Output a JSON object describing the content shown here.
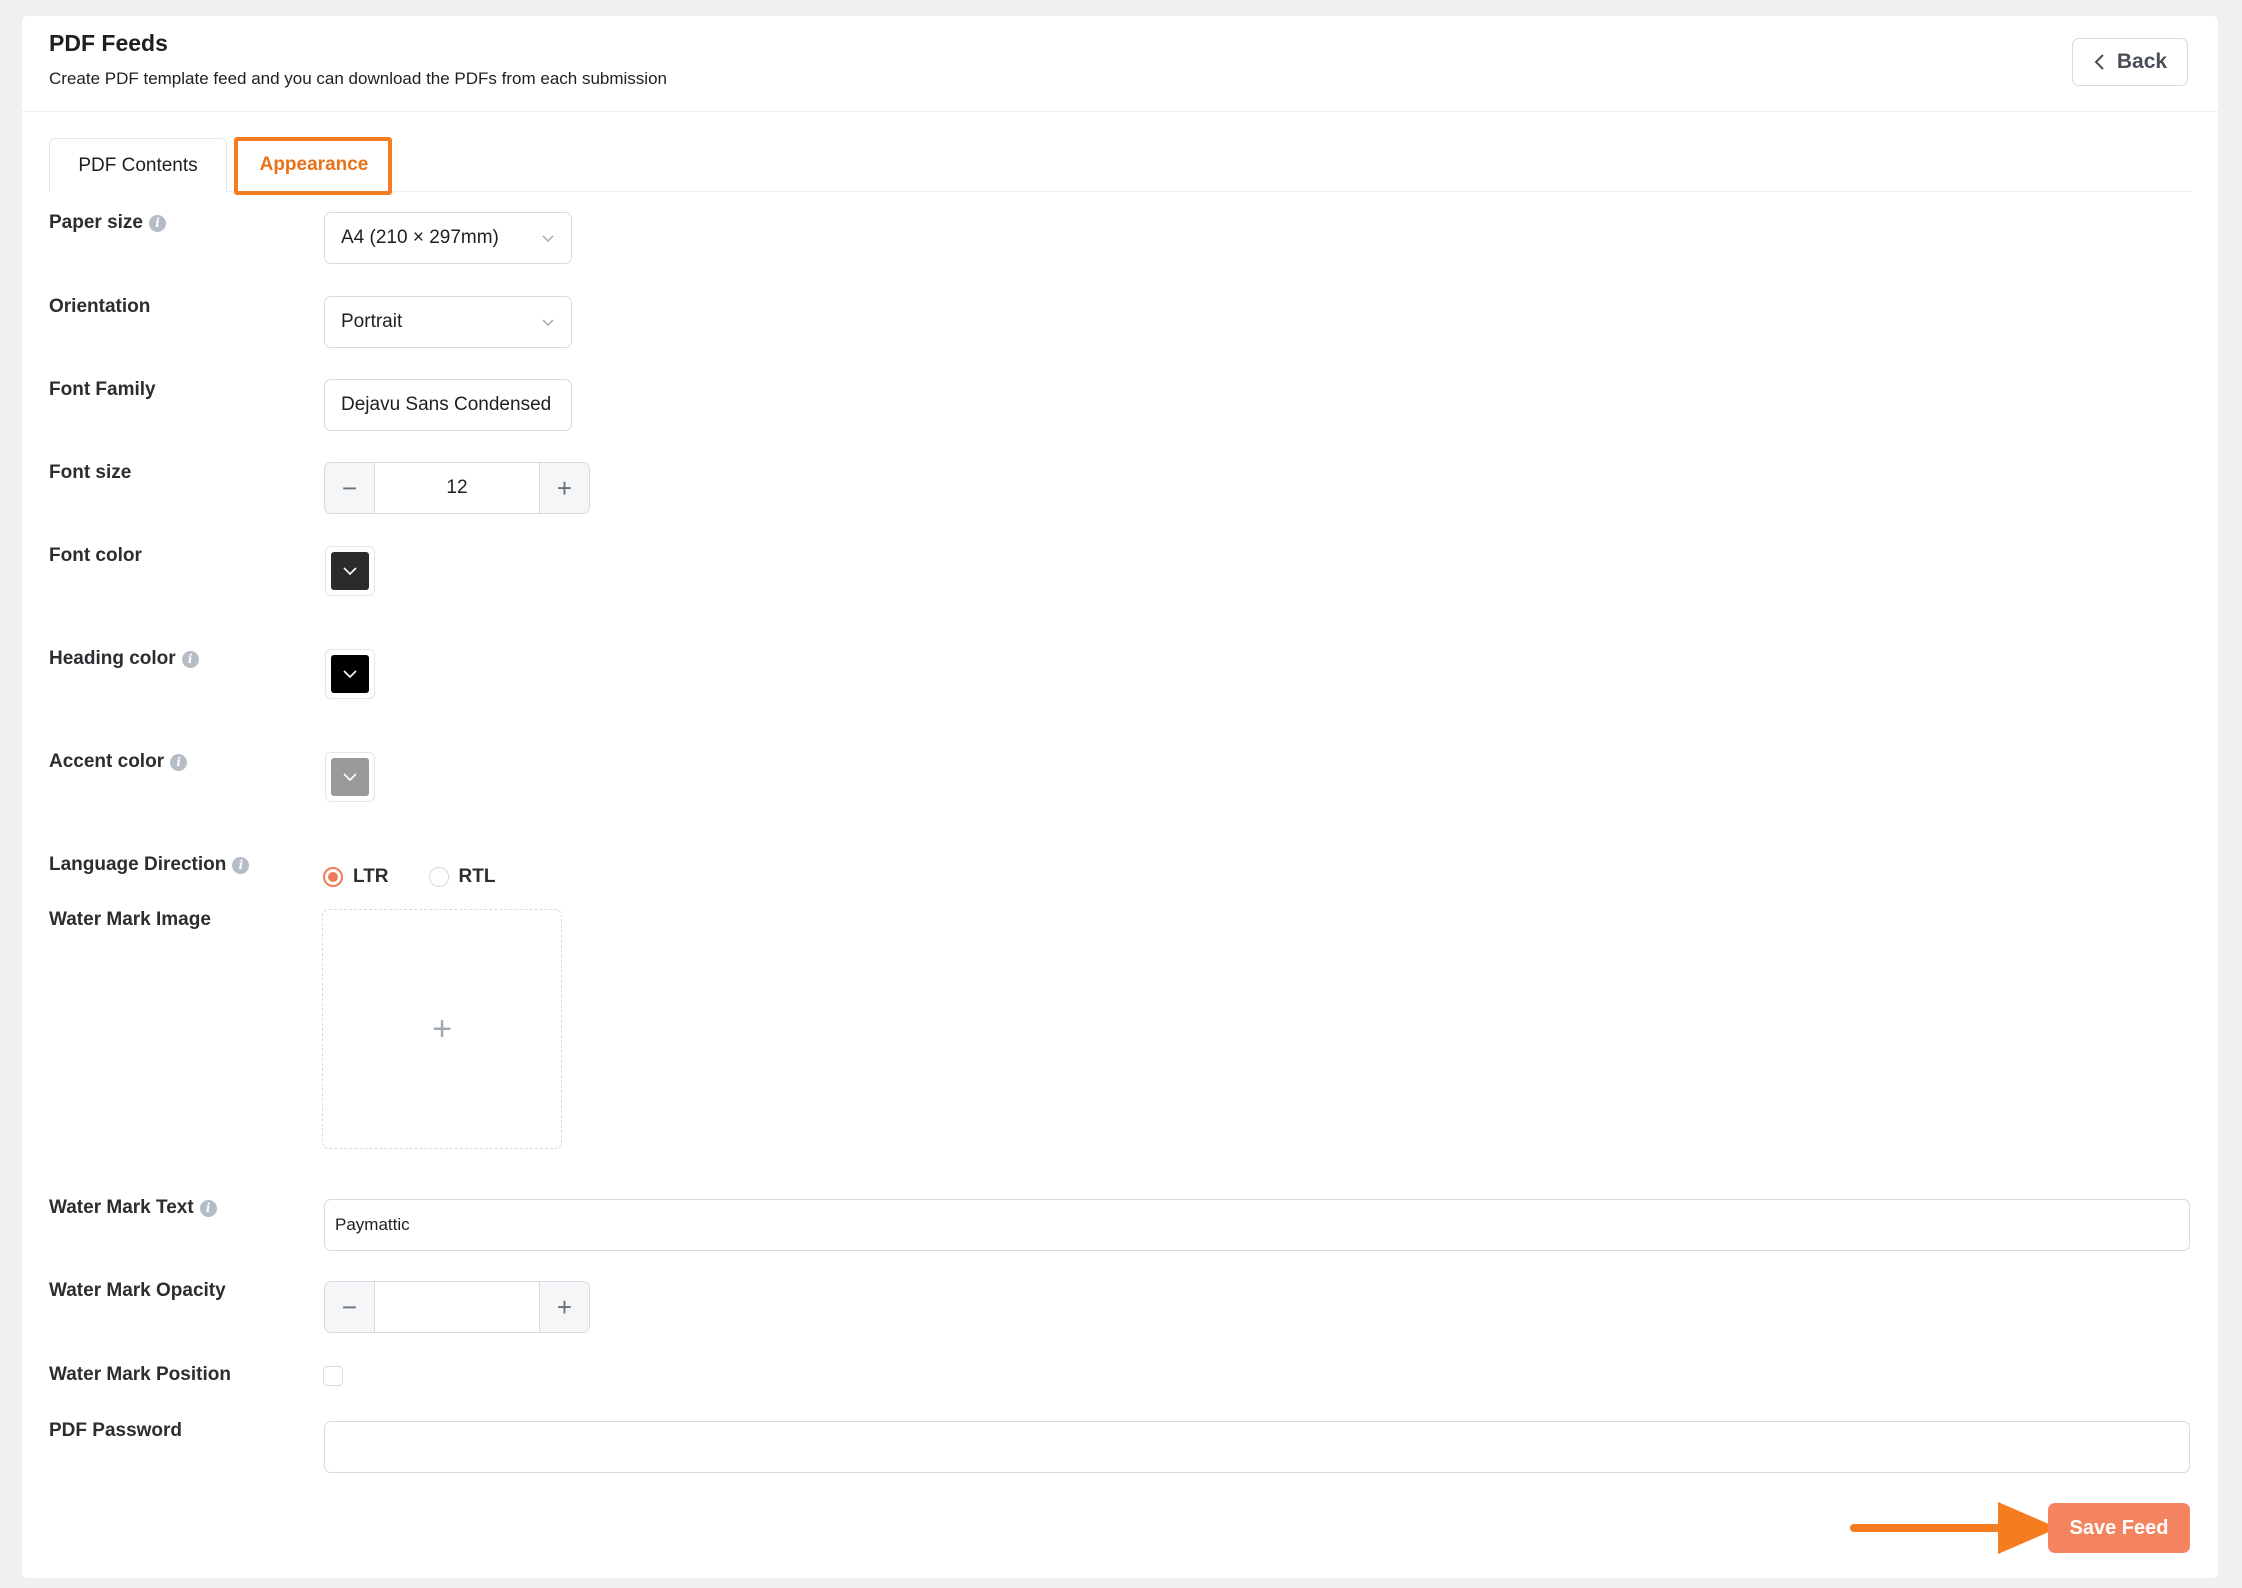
{
  "header": {
    "title": "PDF Feeds",
    "subtitle": "Create PDF template feed and you can download the PDFs from each submission",
    "back_label": "Back"
  },
  "tabs": [
    {
      "label": "PDF Contents",
      "active": false
    },
    {
      "label": "Appearance",
      "active": true
    }
  ],
  "fields": {
    "paper_size": {
      "label": "Paper size",
      "value": "A4 (210 × 297mm)"
    },
    "orientation": {
      "label": "Orientation",
      "value": "Portrait"
    },
    "font_family": {
      "label": "Font Family",
      "value": "Dejavu Sans Condensed"
    },
    "font_size": {
      "label": "Font size",
      "value": "12"
    },
    "font_color": {
      "label": "Font color",
      "color": "#2b2b2b"
    },
    "heading_color": {
      "label": "Heading color",
      "color": "#000000"
    },
    "accent_color": {
      "label": "Accent color",
      "color": "#999999"
    },
    "language_direction": {
      "label": "Language Direction",
      "options": [
        "LTR",
        "RTL"
      ],
      "selected": "LTR"
    },
    "watermark_image": {
      "label": "Water Mark Image"
    },
    "watermark_text": {
      "label": "Water Mark Text",
      "value": "Paymattic"
    },
    "watermark_opacity": {
      "label": "Water Mark Opacity",
      "value": ""
    },
    "watermark_position": {
      "label": "Water Mark Position",
      "checked": false
    },
    "pdf_password": {
      "label": "PDF Password",
      "value": ""
    }
  },
  "save_label": "Save Feed",
  "colors": {
    "accent": "#e8721c",
    "save_button": "#f4845f",
    "highlight": "#f57c1f"
  }
}
